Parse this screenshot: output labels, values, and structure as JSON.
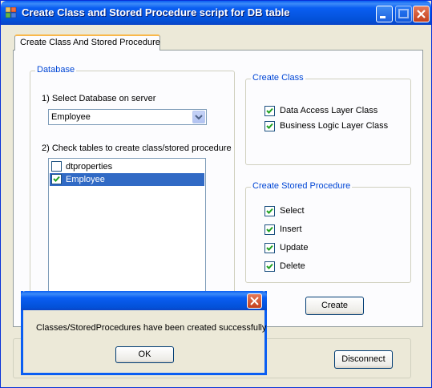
{
  "window": {
    "title": "Create Class and Stored Procedure script for DB table",
    "app_icon": "app-window-icon",
    "controls": [
      "minimize-icon",
      "maximize-icon",
      "close-icon"
    ]
  },
  "tab": {
    "label": "Create Class And Stored Procedure"
  },
  "database": {
    "group_label": "Database",
    "select_label": "1) Select Database on server",
    "selected_database": "Employee",
    "tables_label": "2) Check tables to create class/stored procedure",
    "tables": [
      {
        "name": "dtproperties",
        "checked": false,
        "selected": false
      },
      {
        "name": "Employee",
        "checked": true,
        "selected": true
      }
    ]
  },
  "create_class": {
    "group_label": "Create Class",
    "options": [
      {
        "label": "Data Access Layer Class",
        "checked": true
      },
      {
        "label": "Business Logic Layer Class",
        "checked": true
      }
    ]
  },
  "create_sp": {
    "group_label": "Create Stored Procedure",
    "options": [
      {
        "label": "Select",
        "checked": true
      },
      {
        "label": "Insert",
        "checked": true
      },
      {
        "label": "Update",
        "checked": true
      },
      {
        "label": "Delete",
        "checked": true
      }
    ]
  },
  "buttons": {
    "create": "Create",
    "disconnect": "Disconnect"
  },
  "message_box": {
    "message": "Classes/StoredProcedures have been created successfully",
    "ok": "OK"
  },
  "colors": {
    "titlebar": "#0a5ef2",
    "selection": "#316ac5",
    "group_label": "#0046d5",
    "tab_accent": "#f9b84b"
  }
}
